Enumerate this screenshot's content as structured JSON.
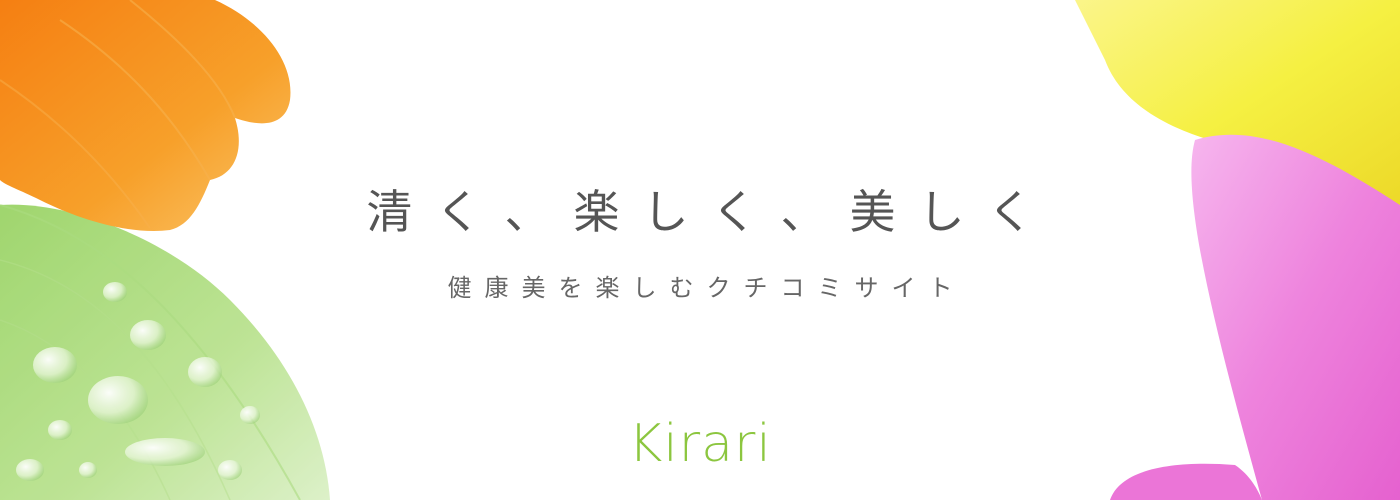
{
  "hero": {
    "headline": "清く、楽しく、美しく",
    "subheadline": "健康美を楽しむクチコミサイト",
    "logo_text": "Kirari"
  },
  "decorations": {
    "orange_petal": "#f5921e",
    "green_leaf": "#a8d86e",
    "yellow_petal": "#f3ef3d",
    "pink_petal": "#ee7fd9"
  },
  "colors": {
    "brand_green": "#8cc63f",
    "text_gray": "#555555"
  }
}
